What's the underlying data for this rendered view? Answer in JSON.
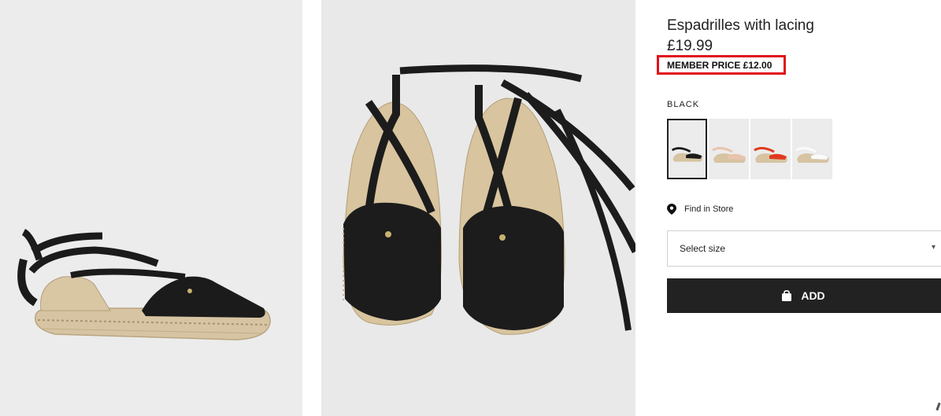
{
  "product": {
    "title": "Espadrilles with lacing",
    "price": "£19.99",
    "member_price": "MEMBER PRICE £12.00",
    "color_label": "BLACK"
  },
  "swatches": [
    {
      "name": "black",
      "color": "#1a1a1a"
    },
    {
      "name": "beige",
      "color": "#e8c4ae"
    },
    {
      "name": "red",
      "color": "#e03a1e"
    },
    {
      "name": "white",
      "color": "#f3f3f3"
    }
  ],
  "find_in_store": {
    "label": "Find in Store",
    "icon": "location-pin-icon"
  },
  "size_select": {
    "placeholder": "Select size"
  },
  "add_button": {
    "label": "ADD",
    "icon": "shopping-bag-icon"
  },
  "colors": {
    "highlight": "#e0121b",
    "button_bg": "#222222",
    "jute": "#d8c4a0"
  }
}
